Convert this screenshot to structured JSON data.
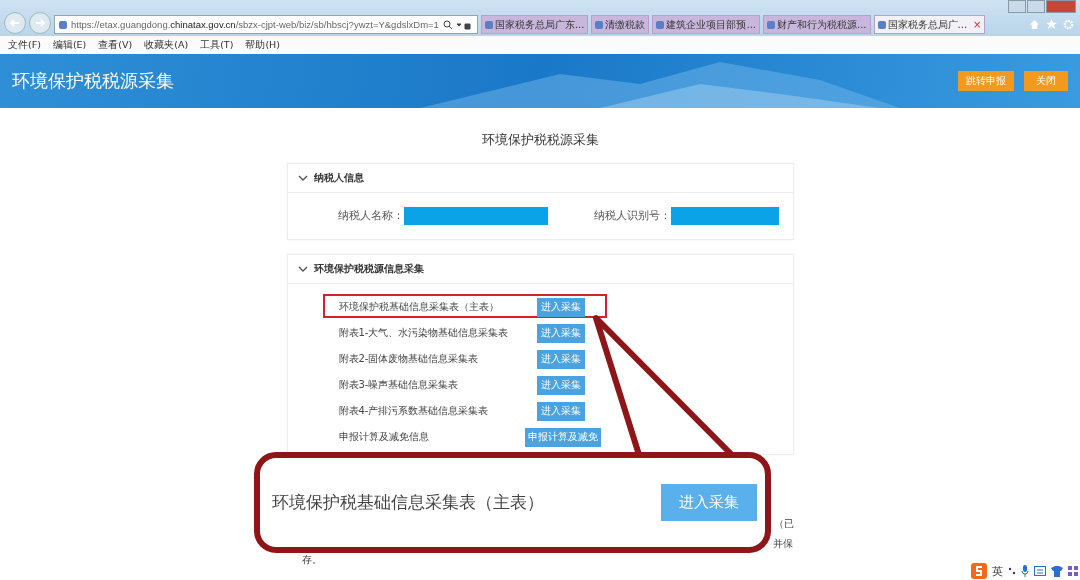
{
  "browser": {
    "url": "https://etax.guangdong.**chinatax.gov.cn**/sbzx-cjpt-web/biz/sb/hbscj?ywzt=Y&gdslxDm=1",
    "tabs": [
      {
        "title": "国家税务总局广东...",
        "selected": false
      },
      {
        "title": "清缴税款",
        "selected": false
      },
      {
        "title": "建筑企业项目部预...",
        "selected": false
      },
      {
        "title": "财产和行为税税源...",
        "selected": false
      },
      {
        "title": "国家税务总局广...",
        "selected": true,
        "close": "×"
      }
    ],
    "menu": [
      "文件(F)",
      "编辑(E)",
      "查看(V)",
      "收藏夹(A)",
      "工具(T)",
      "帮助(H)"
    ]
  },
  "header": {
    "title": "环境保护税税源采集",
    "buttons": [
      "跳转申报",
      "关闭"
    ]
  },
  "page_title": "环境保护税税源采集",
  "taxpayer_section": {
    "title": "纳税人信息",
    "expanded": true,
    "fields": [
      {
        "label": "纳税人名称："
      },
      {
        "label": "纳税人识别号："
      }
    ]
  },
  "collection_section": {
    "title": "环境保护税税源信息采集",
    "expanded": true,
    "rows": [
      {
        "label": "环境保护税基础信息采集表（主表）",
        "button": "进入采集",
        "highlighted": true
      },
      {
        "label": "附表1-大气、水污染物基础信息采集表",
        "button": "进入采集",
        "highlighted": false
      },
      {
        "label": "附表2-固体废物基础信息采集表",
        "button": "进入采集",
        "highlighted": false
      },
      {
        "label": "附表3-噪声基础信息采集表",
        "button": "进入采集",
        "highlighted": false
      },
      {
        "label": "附表4-产排污系数基础信息采集表",
        "button": "进入采集",
        "highlighted": false
      },
      {
        "label": "申报计算及减免信息",
        "button": "申报计算及减免",
        "highlighted": false
      }
    ]
  },
  "note_fragments": [
    "（已",
    "并保",
    "存。"
  ],
  "callout": {
    "label": "环境保护税基础信息采集表（主表）",
    "button": "进入采集"
  },
  "ime_toolbar": {
    "mode": "英"
  }
}
